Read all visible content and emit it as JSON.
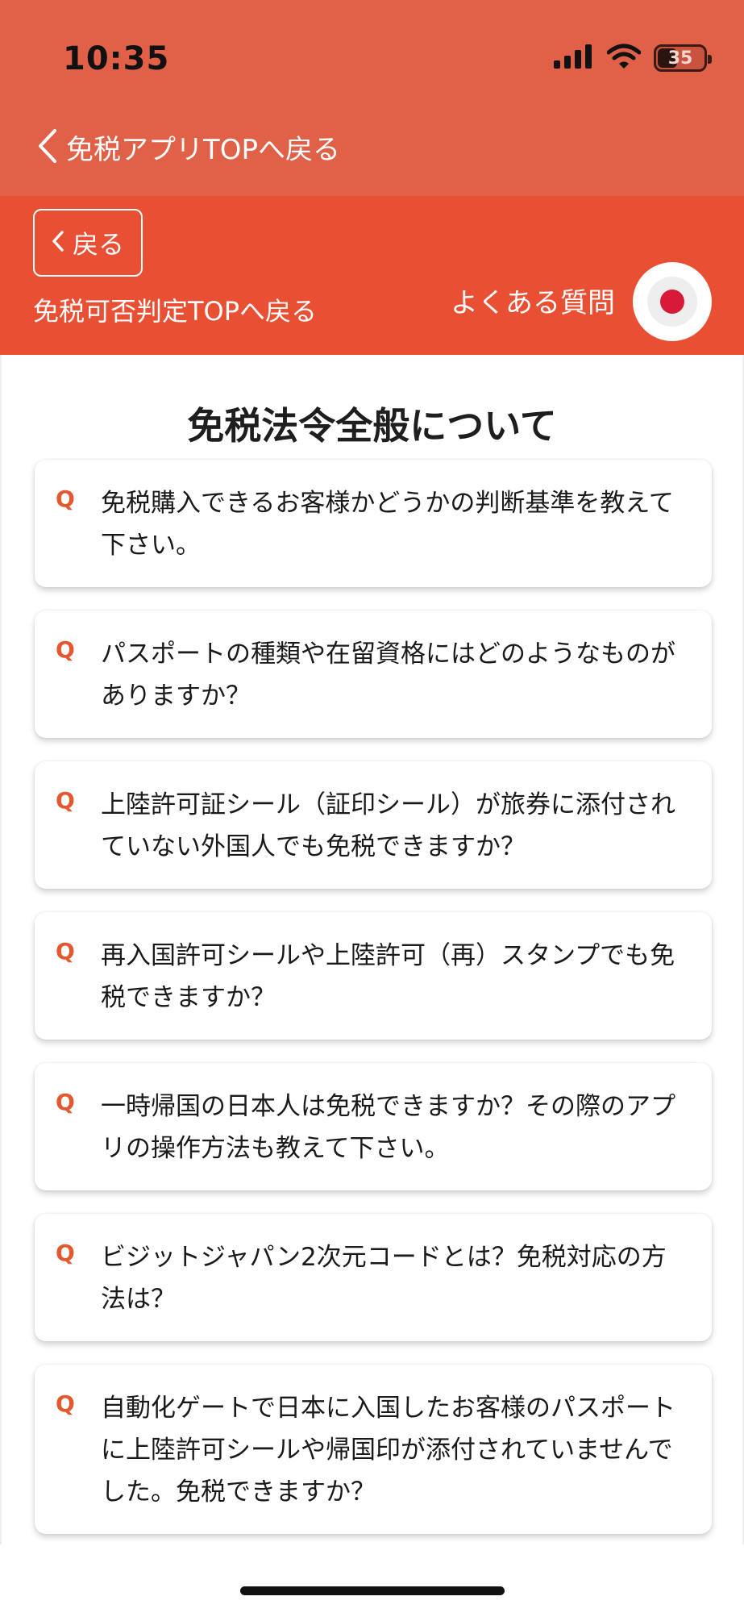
{
  "status_bar": {
    "time": "10:35",
    "battery": "35"
  },
  "nav": {
    "app_top_back": "免税アプリTOPへ戻る",
    "back_button": "戻る",
    "judge_top_back": "免税可否判定TOPへ戻る",
    "faq": "よくある質問",
    "language_flag": "japan-flag-icon"
  },
  "colors": {
    "top_bar": "#e06048",
    "header": "#e84f33",
    "q_mark": "#e4582f",
    "flag_red": "#d91a36"
  },
  "section": {
    "title": "免税法令全般について"
  },
  "faq_items": [
    {
      "mark": "Q",
      "question": "免税購入できるお客様かどうかの判断基準を教えて下さい。"
    },
    {
      "mark": "Q",
      "question": "パスポートの種類や在留資格にはどのようなものがありますか？"
    },
    {
      "mark": "Q",
      "question": "上陸許可証シール（証印シール）が旅券に添付されていない外国人でも免税できますか？"
    },
    {
      "mark": "Q",
      "question": "再入国許可シールや上陸許可（再）スタンプでも免税できますか？"
    },
    {
      "mark": "Q",
      "question": "一時帰国の日本人は免税できますか？その際のアプリの操作方法も教えて下さい。"
    },
    {
      "mark": "Q",
      "question": "ビジットジャパン2次元コードとは？免税対応の方法は？"
    },
    {
      "mark": "Q",
      "question": "自動化ゲートで日本に入国したお客様のパスポートに上陸許可シールや帰国印が添付されていませんでした。免税できますか？"
    }
  ]
}
